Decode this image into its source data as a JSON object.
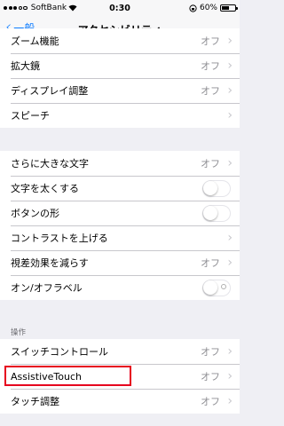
{
  "status": {
    "carrier": "SoftBank",
    "time": "0:30",
    "battery": "60%",
    "battery_level": 0.6
  },
  "nav": {
    "back_label": "一般",
    "title": "アクセシビリティ"
  },
  "section1": [
    {
      "label": "ズーム機能",
      "value": "オフ"
    },
    {
      "label": "拡大鏡",
      "value": "オフ"
    },
    {
      "label": "ディスプレイ調整",
      "value": "オフ"
    },
    {
      "label": "スピーチ"
    }
  ],
  "section2": [
    {
      "label": "さらに大きな文字",
      "value": "オフ"
    },
    {
      "label": "文字を太くする",
      "toggle": false
    },
    {
      "label": "ボタンの形",
      "toggle": false
    },
    {
      "label": "コントラストを上げる"
    },
    {
      "label": "視差効果を減らす",
      "value": "オフ"
    },
    {
      "label": "オン/オフラベル",
      "toggle": false
    }
  ],
  "section3_header": "操作",
  "section3": [
    {
      "label": "スイッチコントロール",
      "value": "オフ"
    },
    {
      "label": "AssistiveTouch",
      "value": "オフ"
    },
    {
      "label": "タッチ調整",
      "value": "オフ"
    }
  ],
  "colors": {
    "accent": "#0a7aff",
    "highlight": "#e6001e",
    "background": "#efeff4"
  }
}
